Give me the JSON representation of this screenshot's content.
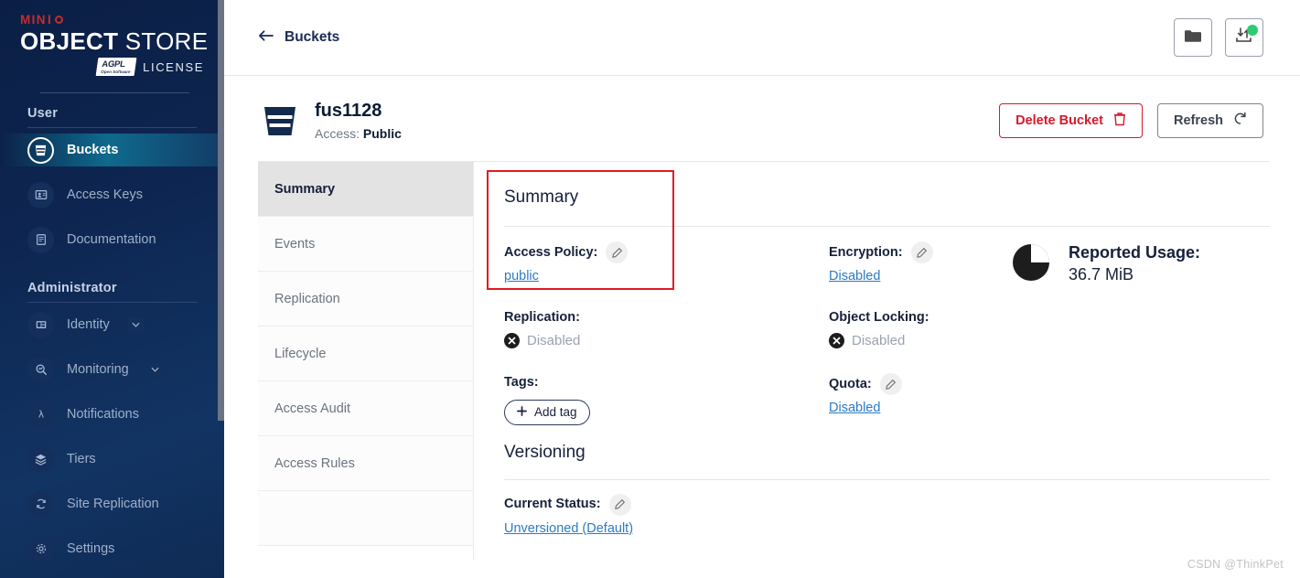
{
  "sidebar": {
    "logo": {
      "minio": "MIN",
      "minio_o": "O",
      "object": "OBJECT",
      "store": " STORE",
      "license_badge_top": "AGPL",
      "license_badge_bottom": "Open Software",
      "license_text": "LICENSE"
    },
    "sections": [
      {
        "label": "User",
        "items": [
          {
            "label": "Buckets",
            "icon": "bucket-icon",
            "active": true,
            "expandable": false
          },
          {
            "label": "Access Keys",
            "icon": "access-keys-icon",
            "active": false,
            "expandable": false
          },
          {
            "label": "Documentation",
            "icon": "documentation-icon",
            "active": false,
            "expandable": false
          }
        ]
      },
      {
        "label": "Administrator",
        "items": [
          {
            "label": "Identity",
            "icon": "identity-icon",
            "active": false,
            "expandable": true
          },
          {
            "label": "Monitoring",
            "icon": "monitoring-icon",
            "active": false,
            "expandable": true
          },
          {
            "label": "Notifications",
            "icon": "lambda-icon",
            "active": false,
            "expandable": false
          },
          {
            "label": "Tiers",
            "icon": "tiers-icon",
            "active": false,
            "expandable": false
          },
          {
            "label": "Site Replication",
            "icon": "site-replication-icon",
            "active": false,
            "expandable": false
          },
          {
            "label": "Settings",
            "icon": "settings-gear-icon",
            "active": false,
            "expandable": false
          }
        ]
      }
    ]
  },
  "topbar": {
    "back_label": "Buckets",
    "buttons": [
      {
        "name": "folder-browser-button",
        "icon": "folder-icon",
        "badge": false
      },
      {
        "name": "transfer-manager-button",
        "icon": "upload-download-icon",
        "badge": true
      }
    ]
  },
  "bucket": {
    "name": "fus1128",
    "access_label": "Access: ",
    "access_value": "Public",
    "delete_button": "Delete Bucket",
    "refresh_button": "Refresh"
  },
  "tabs": [
    {
      "label": "Summary",
      "active": true
    },
    {
      "label": "Events",
      "active": false
    },
    {
      "label": "Replication",
      "active": false
    },
    {
      "label": "Lifecycle",
      "active": false
    },
    {
      "label": "Access Audit",
      "active": false
    },
    {
      "label": "Access Rules",
      "active": false
    }
  ],
  "summary": {
    "title": "Summary",
    "access_policy": {
      "label": "Access Policy:",
      "value": "public"
    },
    "replication": {
      "label": "Replication:",
      "value": "Disabled"
    },
    "tags": {
      "label": "Tags:",
      "add_label": "Add tag"
    },
    "encryption": {
      "label": "Encryption:",
      "value": "Disabled"
    },
    "object_locking": {
      "label": "Object Locking:",
      "value": "Disabled"
    },
    "quota": {
      "label": "Quota:",
      "value": "Disabled"
    },
    "reported_usage": {
      "label": "Reported Usage:",
      "value": "36.7 MiB"
    }
  },
  "versioning": {
    "title": "Versioning",
    "current_status_label": "Current Status:",
    "current_status_value": "Unversioned (Default)"
  },
  "watermark": "CSDN @ThinkPet",
  "colors": {
    "sidebar_bg": "#0d2550",
    "accent_active": "#0f6a8e",
    "danger": "#d9182c",
    "link": "#2a7bc7",
    "badge_green": "#2ecc71",
    "highlight_box": "#e01b24"
  }
}
